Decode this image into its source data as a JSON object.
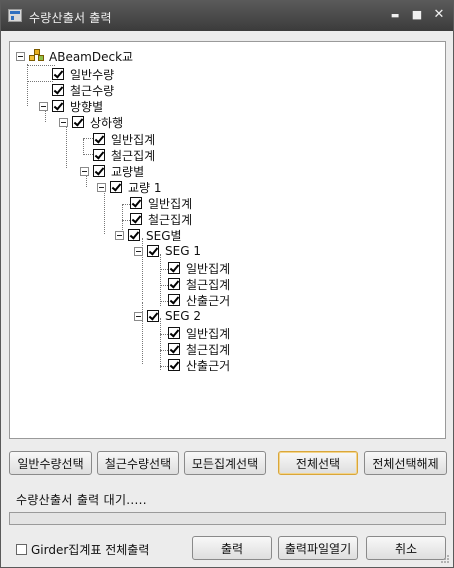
{
  "window": {
    "title": "수량산출서 출력"
  },
  "titlebar_buttons": {
    "minimize": "▬",
    "maximize": "■",
    "close": "✕"
  },
  "tree": {
    "root": "ABeamDeck교",
    "items": [
      {
        "label": "일반수량"
      },
      {
        "label": "철근수량"
      },
      {
        "label": "방향별"
      },
      {
        "label": "상하행"
      },
      {
        "label": "일반집계"
      },
      {
        "label": "철근집계"
      },
      {
        "label": "교량별"
      },
      {
        "label": "교량 1"
      },
      {
        "label": "일반집계"
      },
      {
        "label": "철근집계"
      },
      {
        "label": "SEG별"
      },
      {
        "label": "SEG 1"
      },
      {
        "label": "일반집계"
      },
      {
        "label": "철근집계"
      },
      {
        "label": "산출근거"
      },
      {
        "label": "SEG 2"
      },
      {
        "label": "일반집계"
      },
      {
        "label": "철근집계"
      },
      {
        "label": "산출근거"
      }
    ]
  },
  "selection_buttons": {
    "general": "일반수량선택",
    "rebar": "철근수량선택",
    "all_totals": "모든집계선택",
    "select_all": "전체선택",
    "deselect_all": "전체선택해제"
  },
  "status": {
    "text": "수량산출서 출력 대기.....",
    "progress": 0
  },
  "girder": {
    "label": "Girder집계표 전체출력"
  },
  "action_buttons": {
    "output": "출력",
    "open_file": "출력파일열기",
    "cancel": "취소"
  },
  "colors": {
    "titlebar": "#4a4a4a",
    "focus_border": "#d9a63a",
    "progress_fill": "#3f8f3f"
  }
}
